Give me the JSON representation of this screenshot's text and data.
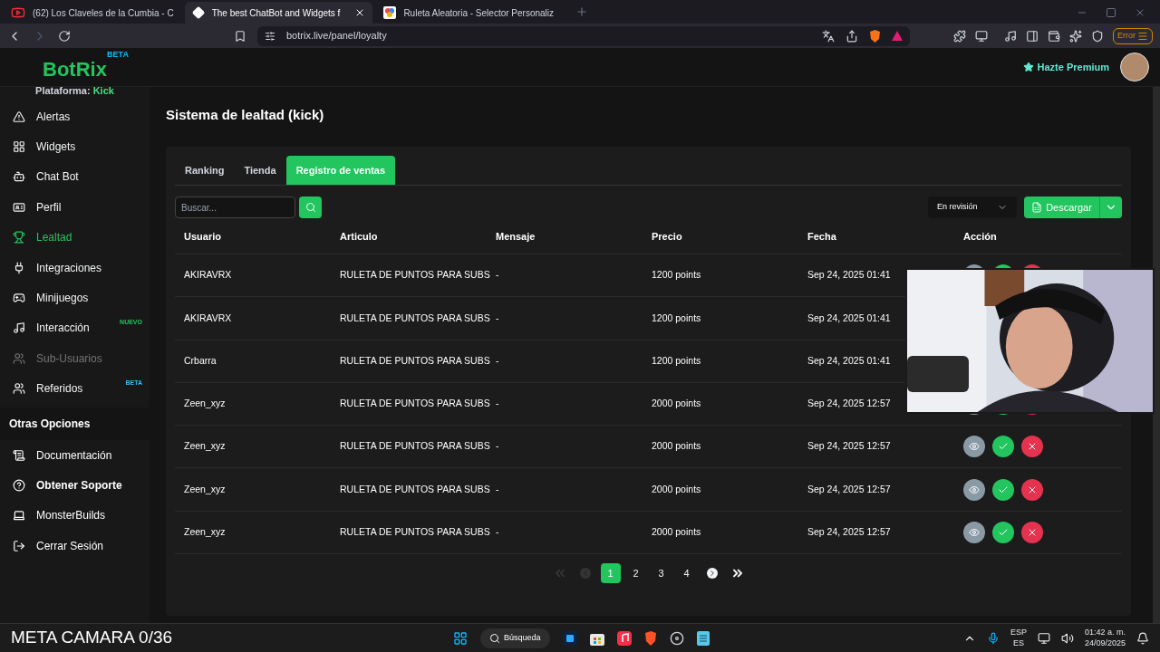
{
  "browser": {
    "tabs": [
      {
        "title": "(62) Los Claveles de la Cumbia - C",
        "selected": false
      },
      {
        "title": "The best ChatBot and Widgets f",
        "selected": true
      },
      {
        "title": "Ruleta Aleatoria - Selector Personaliz",
        "selected": false
      }
    ],
    "url": "botrix.live/panel/loyalty",
    "error_button": "Error"
  },
  "header": {
    "logo": "BotRix",
    "logo_badge": "BETA",
    "premium": "Hazte Premium"
  },
  "sidebar": {
    "platform_label": "Plataforma:",
    "platform": "Kick",
    "items": [
      {
        "label": "Alertas",
        "selected": false,
        "disabled": false
      },
      {
        "label": "Widgets",
        "selected": false,
        "disabled": false
      },
      {
        "label": "Chat Bot",
        "selected": false,
        "disabled": false
      },
      {
        "label": "Perfil",
        "selected": false,
        "disabled": false
      },
      {
        "label": "Lealtad",
        "selected": true,
        "disabled": false
      },
      {
        "label": "Integraciones",
        "selected": false,
        "disabled": false
      },
      {
        "label": "Minijuegos",
        "selected": false,
        "disabled": false
      },
      {
        "label": "Interacción",
        "selected": false,
        "disabled": false,
        "badge": "NUEVO"
      },
      {
        "label": "Sub-Usuarios",
        "selected": false,
        "disabled": true
      },
      {
        "label": "Referidos",
        "selected": false,
        "disabled": false,
        "badge": "BETA"
      }
    ],
    "section": "Otras Opciones",
    "other_items": [
      {
        "label": "Documentación",
        "bold": false
      },
      {
        "label": "Obtener Soporte",
        "bold": true
      },
      {
        "label": "MonsterBuilds",
        "bold": false
      },
      {
        "label": "Cerrar Sesión",
        "bold": false
      }
    ]
  },
  "page": {
    "title": "Sistema de lealtad (kick)",
    "tabs": [
      {
        "label": "Ranking",
        "selected": false
      },
      {
        "label": "Tienda",
        "selected": false
      },
      {
        "label": "Registro de ventas",
        "selected": true
      }
    ],
    "search": {
      "placeholder": "Buscar..."
    },
    "filter": "En revisión",
    "download": "Descargar",
    "table": {
      "columns": [
        "Usuario",
        "Articulo",
        "Mensaje",
        "Precio",
        "Fecha",
        "Acción"
      ],
      "rows": [
        {
          "cells": [
            "AKIRAVRX",
            "RULETA DE PUNTOS PARA SUBS",
            "-",
            "1200 points",
            "Sep 24, 2025 01:41"
          ]
        },
        {
          "cells": [
            "AKIRAVRX",
            "RULETA DE PUNTOS PARA SUBS",
            "-",
            "1200 points",
            "Sep 24, 2025 01:41"
          ]
        },
        {
          "cells": [
            "Crbarra",
            "RULETA DE PUNTOS PARA SUBS",
            "-",
            "1200 points",
            "Sep 24, 2025 01:41"
          ]
        },
        {
          "cells": [
            "Zeen_xyz",
            "RULETA DE PUNTOS PARA SUBS",
            "-",
            "2000 points",
            "Sep 24, 2025 12:57"
          ]
        },
        {
          "cells": [
            "Zeen_xyz",
            "RULETA DE PUNTOS PARA SUBS",
            "-",
            "2000 points",
            "Sep 24, 2025 12:57"
          ]
        },
        {
          "cells": [
            "Zeen_xyz",
            "RULETA DE PUNTOS PARA SUBS",
            "-",
            "2000 points",
            "Sep 24, 2025 12:57"
          ]
        },
        {
          "cells": [
            "Zeen_xyz",
            "RULETA DE PUNTOS PARA SUBS",
            "-",
            "2000 points",
            "Sep 24, 2025 12:57"
          ]
        }
      ]
    },
    "pagination": [
      {
        "kind": "first",
        "disabled": true,
        "selected": false
      },
      {
        "kind": "prev",
        "disabled": true,
        "selected": false
      },
      {
        "kind": "page",
        "label": "1",
        "selected": true
      },
      {
        "kind": "page",
        "label": "2",
        "selected": false
      },
      {
        "kind": "page",
        "label": "3",
        "selected": false
      },
      {
        "kind": "page",
        "label": "4",
        "selected": false
      },
      {
        "kind": "next",
        "disabled": false,
        "selected": false
      },
      {
        "kind": "last",
        "disabled": false,
        "selected": false
      }
    ]
  },
  "overlay_text": "META CAMARA 0/36",
  "taskbar": {
    "search": "Búsqueda",
    "language": "ESP",
    "region": "ES",
    "time": "01:42 a. m.",
    "date": "24/09/2025"
  }
}
